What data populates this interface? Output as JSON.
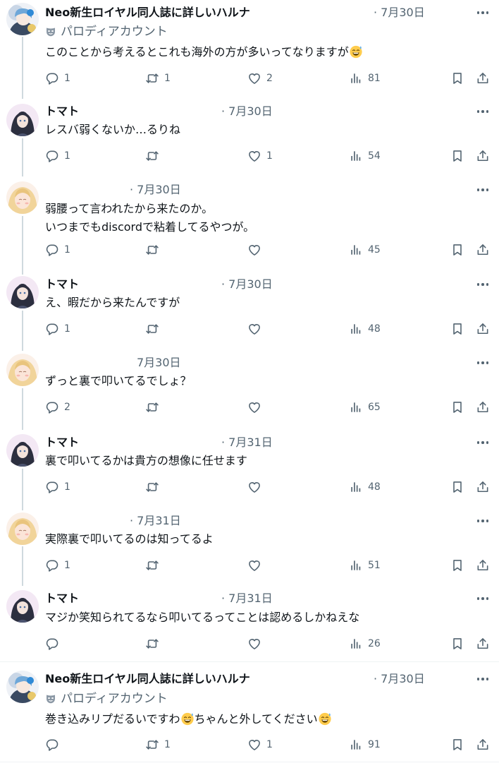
{
  "tweets": [
    {
      "name": "Neo新生ロイヤル同人誌に詳しいハルナ",
      "date": "· 7月30日",
      "parody_label": "パロディアカウント",
      "text_a": "このことから考えるとこれも海外の方が多いってなりますが",
      "text_b": "",
      "reply_count": "1",
      "retweet_count": "1",
      "like_count": "2",
      "view_count": "81",
      "avatar_style": "blue"
    },
    {
      "name": "トマト",
      "date": "· 7月30日",
      "text_a": "レスバ弱くないか…るりね",
      "reply_count": "1",
      "retweet_count": "",
      "like_count": "1",
      "view_count": "54",
      "avatar_style": "dark"
    },
    {
      "name": "",
      "date": "· 7月30日",
      "text_a": "弱腰って言われたから来たのか。\nいつまでもdiscordで粘着してるやつが。",
      "reply_count": "1",
      "retweet_count": "",
      "like_count": "",
      "view_count": "45",
      "avatar_style": "blond"
    },
    {
      "name": "トマト",
      "date": "· 7月30日",
      "text_a": "え、暇だから来たんですが",
      "reply_count": "1",
      "retweet_count": "",
      "like_count": "",
      "view_count": "48",
      "avatar_style": "dark"
    },
    {
      "name": "",
      "date": "7月30日",
      "text_a": "ずっと裏で叩いてるでしょ？",
      "reply_count": "2",
      "retweet_count": "",
      "like_count": "",
      "view_count": "65",
      "avatar_style": "blond"
    },
    {
      "name": "トマト",
      "date": "· 7月31日",
      "text_a": "裏で叩いてるかは貴方の想像に任せます",
      "reply_count": "1",
      "retweet_count": "",
      "like_count": "",
      "view_count": "48",
      "avatar_style": "dark"
    },
    {
      "name": "",
      "date": "· 7月31日",
      "text_a": "実際裏で叩いてるのは知ってるよ",
      "reply_count": "1",
      "retweet_count": "",
      "like_count": "",
      "view_count": "51",
      "avatar_style": "blond"
    },
    {
      "name": "トマト",
      "date": "· 7月31日",
      "text_a": "マジか笑知られてるなら叩いてるってことは認めるしかねえな",
      "reply_count": "",
      "retweet_count": "",
      "like_count": "",
      "view_count": "26",
      "avatar_style": "dark"
    },
    {
      "name": "Neo新生ロイヤル同人誌に詳しいハルナ",
      "date": "· 7月30日",
      "parody_label": "パロディアカウント",
      "text_a": "巻き込みリプだるいですわ",
      "text_b": "ちゃんと外してください",
      "reply_count": "",
      "retweet_count": "1",
      "like_count": "1",
      "view_count": "91",
      "avatar_style": "blue"
    }
  ],
  "icons": {
    "reply": "reply-icon",
    "retweet": "retweet-icon",
    "like": "heart-icon",
    "views": "views-bar-chart-icon",
    "bookmark": "bookmark-icon",
    "share": "share-icon",
    "more": "more-dots-icon",
    "parody": "theater-mask-icon",
    "emoji": "sweat-smile-emoji"
  },
  "colors": {
    "text": "#0f1419",
    "secondary": "#536471",
    "thread_line": "#cfd9de",
    "divider": "#eff3f4"
  }
}
